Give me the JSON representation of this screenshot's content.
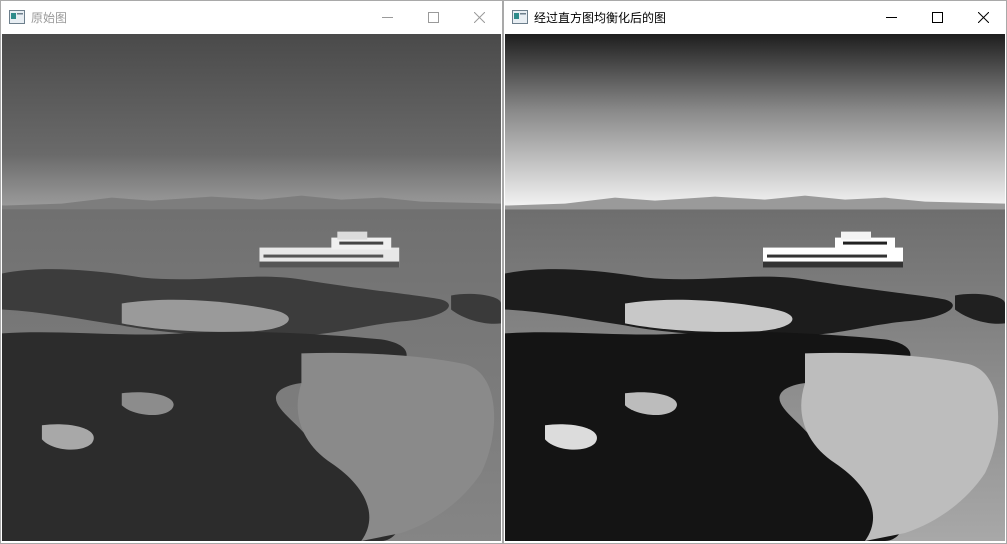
{
  "windows": [
    {
      "title": "原始图",
      "icon": "window-app-icon",
      "controls": [
        "minimize-icon",
        "maximize-icon",
        "close-icon"
      ],
      "image": "grayscale-original-photo"
    },
    {
      "title": "经过直方图均衡化后的图",
      "icon": "window-app-icon",
      "controls": [
        "minimize-icon",
        "maximize-icon",
        "close-icon"
      ],
      "image": "histogram-equalized-photo"
    }
  ],
  "colors": {
    "title_active": "#000000",
    "title_inactive": "#9a9a9a",
    "border": "#a9a9a9"
  }
}
